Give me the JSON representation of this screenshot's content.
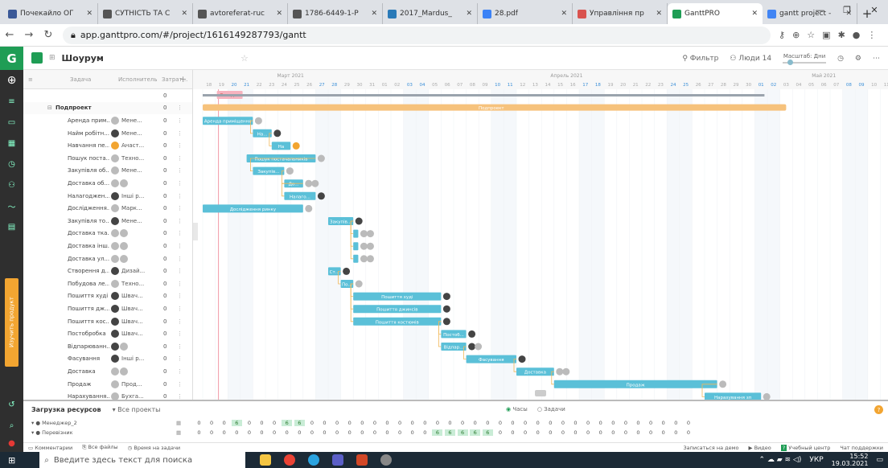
{
  "browser": {
    "tabs": [
      {
        "title": "Почекайло ОГ",
        "color": "#3b5998",
        "active": false
      },
      {
        "title": "СУТНІСТЬ ТА С",
        "color": "#555",
        "active": false
      },
      {
        "title": "avtoreferat-ruc",
        "color": "#555",
        "active": false
      },
      {
        "title": "1786-6449-1-P",
        "color": "#555",
        "active": false
      },
      {
        "title": "2017_Mardus_",
        "color": "#2a7ab8",
        "active": false
      },
      {
        "title": "28.pdf",
        "color": "#3b82f6",
        "active": false
      },
      {
        "title": "Управління пр",
        "color": "#d9534f",
        "active": false
      },
      {
        "title": "GanttPRO",
        "color": "#1f9d55",
        "active": true
      },
      {
        "title": "gantt project -",
        "color": "#4285f4",
        "active": false
      }
    ],
    "url": "app.ganttpro.com/#/project/1616149287793/gantt"
  },
  "app": {
    "logo": "G",
    "project_name": "Шоурум",
    "filter_label": "Фильтр",
    "people_label": "Люди",
    "people_count": "14",
    "scale_label": "Масштаб: Дни",
    "learn_label": "Изучить продукт"
  },
  "grid": {
    "headers": {
      "task": "Задача",
      "assignee": "Исполнитель",
      "cost": "Затрат..."
    },
    "rows": [
      {
        "name": "",
        "assignee": "",
        "cost": "0",
        "indent": 0,
        "av": ""
      },
      {
        "name": "Подпроект",
        "assignee": "",
        "cost": "0",
        "indent": 0,
        "av": "",
        "group": true
      },
      {
        "name": "Аренда прим...",
        "assignee": "Мене...",
        "cost": "0",
        "indent": 1,
        "av": "#bbb"
      },
      {
        "name": "Найм робітн...",
        "assignee": "Мене...",
        "cost": "0",
        "indent": 1,
        "av": "#444"
      },
      {
        "name": "Навчання пе...",
        "assignee": "Анаст...",
        "cost": "0",
        "indent": 1,
        "av": "#f2a531"
      },
      {
        "name": "Пошук поста...",
        "assignee": "Техно...",
        "cost": "0",
        "indent": 1,
        "av": "#bbb"
      },
      {
        "name": "Закупівля об...",
        "assignee": "Мене...",
        "cost": "0",
        "indent": 1,
        "av": "#bbb"
      },
      {
        "name": "Доставка об...",
        "assignee": "",
        "cost": "0",
        "indent": 1,
        "av": "#bbb",
        "av2": "#bbb"
      },
      {
        "name": "Налагоджен...",
        "assignee": "Інші р...",
        "cost": "0",
        "indent": 1,
        "av": "#444"
      },
      {
        "name": "Дослідження...",
        "assignee": "Марк...",
        "cost": "0",
        "indent": 1,
        "av": "#bbb"
      },
      {
        "name": "Закупівля то...",
        "assignee": "Мене...",
        "cost": "0",
        "indent": 1,
        "av": "#444"
      },
      {
        "name": "Доставка тка...",
        "assignee": "",
        "cost": "0",
        "indent": 1,
        "av": "#bbb",
        "av2": "#bbb"
      },
      {
        "name": "Доставка інш...",
        "assignee": "",
        "cost": "0",
        "indent": 1,
        "av": "#bbb",
        "av2": "#bbb"
      },
      {
        "name": "Доставка ул...",
        "assignee": "",
        "cost": "0",
        "indent": 1,
        "av": "#bbb",
        "av2": "#bbb"
      },
      {
        "name": "Створення д...",
        "assignee": "Дизай...",
        "cost": "0",
        "indent": 1,
        "av": "#444"
      },
      {
        "name": "Побудова ле...",
        "assignee": "Техно...",
        "cost": "0",
        "indent": 1,
        "av": "#bbb"
      },
      {
        "name": "Пошиття худі",
        "assignee": "Швач...",
        "cost": "0",
        "indent": 1,
        "av": "#444"
      },
      {
        "name": "Пошиття дж...",
        "assignee": "Швач...",
        "cost": "0",
        "indent": 1,
        "av": "#444"
      },
      {
        "name": "Пошиття кос...",
        "assignee": "Швач...",
        "cost": "0",
        "indent": 1,
        "av": "#444"
      },
      {
        "name": "Постобробка",
        "assignee": "Швач...",
        "cost": "0",
        "indent": 1,
        "av": "#444"
      },
      {
        "name": "Відпарюванн...",
        "assignee": "",
        "cost": "0",
        "indent": 1,
        "av": "#444",
        "av2": "#bbb"
      },
      {
        "name": "Фасування",
        "assignee": "Інші р...",
        "cost": "0",
        "indent": 1,
        "av": "#444"
      },
      {
        "name": "Доставка",
        "assignee": "",
        "cost": "0",
        "indent": 1,
        "av": "#bbb",
        "av2": "#bbb"
      },
      {
        "name": "Продаж",
        "assignee": "Прод...",
        "cost": "0",
        "indent": 1,
        "av": "#bbb"
      },
      {
        "name": "Нарахування...",
        "assignee": "Бухга...",
        "cost": "0",
        "indent": 1,
        "av": "#bbb"
      }
    ],
    "add_task": "Добавить задачу",
    "add_milestone": "Добавить веху"
  },
  "timeline": {
    "months": [
      {
        "label": "Март 2021"
      },
      {
        "label": "Апрель 2021"
      },
      {
        "label": "Май 2021"
      }
    ],
    "days": [
      "18",
      "19",
      "20",
      "21",
      "22",
      "23",
      "24",
      "25",
      "26",
      "27",
      "28",
      "29",
      "30",
      "31",
      "01",
      "02",
      "03",
      "04",
      "05",
      "06",
      "07",
      "08",
      "09",
      "10",
      "11",
      "12",
      "13",
      "14",
      "15",
      "16",
      "17",
      "18",
      "19",
      "20",
      "21",
      "22",
      "23",
      "24",
      "25",
      "26",
      "27",
      "28",
      "29",
      "30",
      "01",
      "02",
      "03",
      "04",
      "05",
      "06",
      "07",
      "08",
      "09",
      "10",
      "11"
    ],
    "today_label": "Сегодня",
    "project_bar_label": "Подпроект",
    "bars": [
      {
        "row": 2,
        "start": 0,
        "dur": 4,
        "label": "Аренда приміщення"
      },
      {
        "row": 3,
        "start": 4,
        "dur": 1.5,
        "label": "На..."
      },
      {
        "row": 4,
        "start": 5.5,
        "dur": 1.5,
        "label": "На"
      },
      {
        "row": 5,
        "start": 3.5,
        "dur": 5.5,
        "label": "Пошук постачальників"
      },
      {
        "row": 6,
        "start": 4,
        "dur": 2.5,
        "label": "Закупів..."
      },
      {
        "row": 7,
        "start": 6.5,
        "dur": 1.5,
        "label": "До..."
      },
      {
        "row": 8,
        "start": 6.5,
        "dur": 2.5,
        "label": "Налаго..."
      },
      {
        "row": 9,
        "start": 0,
        "dur": 8,
        "label": "Дослідження ринку"
      },
      {
        "row": 10,
        "start": 10,
        "dur": 2,
        "label": "Закупів..."
      },
      {
        "row": 11,
        "start": 12,
        "dur": 0.4,
        "label": ""
      },
      {
        "row": 12,
        "start": 12,
        "dur": 0.4,
        "label": ""
      },
      {
        "row": 13,
        "start": 12,
        "dur": 0.4,
        "label": ""
      },
      {
        "row": 14,
        "start": 10,
        "dur": 1,
        "label": "Ст..."
      },
      {
        "row": 15,
        "start": 11,
        "dur": 1,
        "label": "По..."
      },
      {
        "row": 16,
        "start": 12,
        "dur": 7,
        "label": "Пошиття худі"
      },
      {
        "row": 17,
        "start": 12,
        "dur": 7,
        "label": "Пошиття джинсів"
      },
      {
        "row": 18,
        "start": 12,
        "dur": 7,
        "label": "Пошиття костюмів"
      },
      {
        "row": 19,
        "start": 19,
        "dur": 2,
        "label": "Постоб..."
      },
      {
        "row": 20,
        "start": 19,
        "dur": 2,
        "label": "Відпар..."
      },
      {
        "row": 21,
        "start": 21,
        "dur": 4,
        "label": "Фасування"
      },
      {
        "row": 22,
        "start": 25,
        "dur": 3,
        "label": "Доставка"
      },
      {
        "row": 23,
        "start": 28,
        "dur": 13,
        "label": "Продаж"
      },
      {
        "row": 24,
        "start": 40,
        "dur": 4.5,
        "label": "Нарахування зп"
      }
    ]
  },
  "resources": {
    "title": "Загрузка ресурсов",
    "all_projects": "Все проекты",
    "hours": "Часы",
    "tasks": "Задачи",
    "people": [
      {
        "name": "Менеджер_2",
        "values": [
          "0",
          "0",
          "0",
          "6",
          "0",
          "0",
          "0",
          "6",
          "6",
          "0",
          "0",
          "0",
          "0",
          "0",
          "0",
          "0",
          "0",
          "0",
          "0",
          "0",
          "0",
          "0",
          "0",
          "0",
          "0",
          "0",
          "0",
          "0",
          "0",
          "0",
          "0",
          "0",
          "0",
          "0",
          "0",
          "0",
          "0",
          "0",
          "0",
          "0"
        ]
      },
      {
        "name": "Перевізник",
        "values": [
          "0",
          "0",
          "0",
          "0",
          "0",
          "0",
          "0",
          "0",
          "0",
          "0",
          "0",
          "0",
          "0",
          "0",
          "0",
          "0",
          "0",
          "0",
          "0",
          "6",
          "6",
          "6",
          "6",
          "6",
          "0",
          "0",
          "0",
          "0",
          "0",
          "0",
          "0",
          "0",
          "0",
          "0",
          "0",
          "0",
          "0",
          "0",
          "0",
          "0"
        ]
      }
    ],
    "bottom_links": [
      "Комментарии",
      "Все файлы",
      "Время на задачи"
    ],
    "right_links": [
      "Записаться на демо",
      "Видео",
      "Учебный центр",
      "Чат поддержки"
    ]
  },
  "taskbar": {
    "search_placeholder": "Введите здесь текст для поиска",
    "lang": "УКР",
    "time": "15:52",
    "date": "19.03.2021"
  }
}
